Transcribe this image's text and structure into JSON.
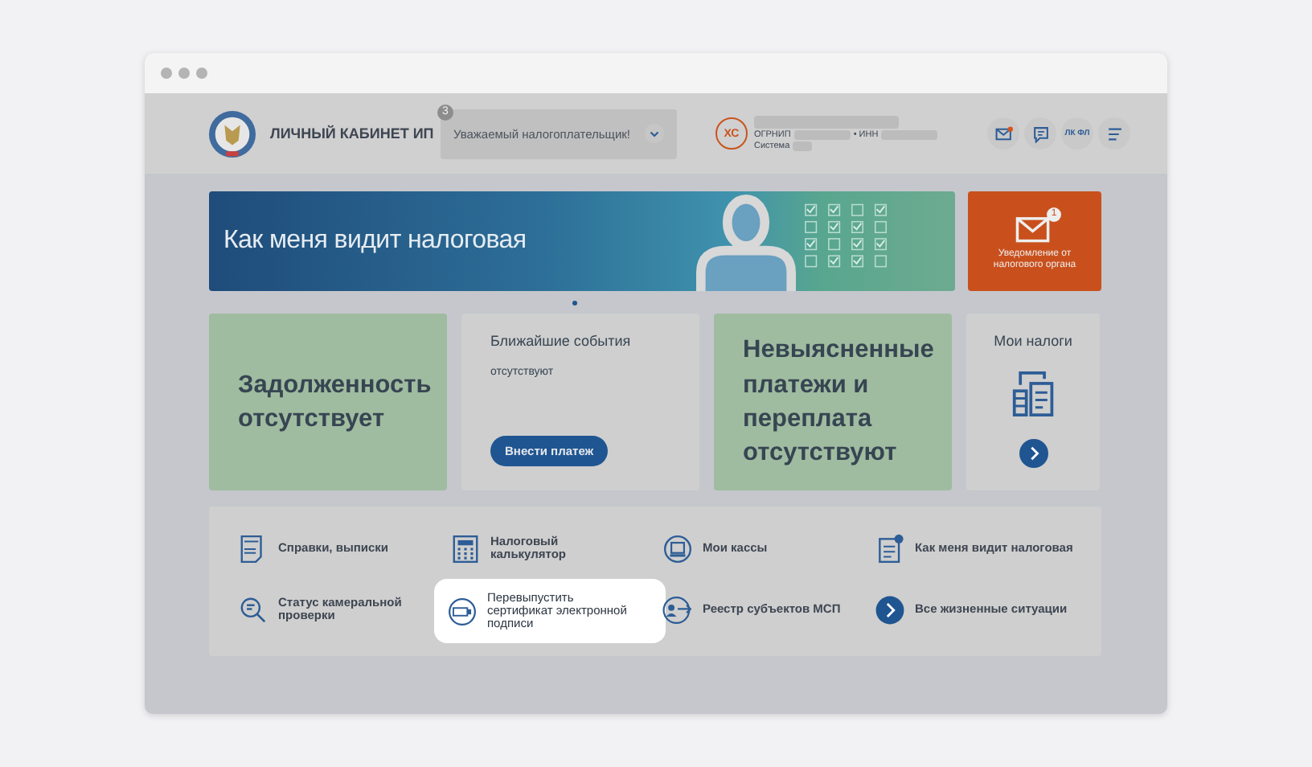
{
  "header": {
    "logo_title": "ЛИЧНЫЙ КАБИНЕТ ИП",
    "message": {
      "badge": "3",
      "text": "Уважаемый налогоплательщик!"
    },
    "user": {
      "initials": "ХС",
      "ogrnip_label": "ОГРНИП",
      "inn_label": "• ИНН",
      "system_label": "Система"
    },
    "actions": [
      {
        "kind": "mail",
        "unread": true
      },
      {
        "kind": "chat"
      },
      {
        "kind": "text",
        "label": "ЛК ФЛ"
      },
      {
        "kind": "menu"
      }
    ]
  },
  "banner": {
    "title": "Как меня видит налоговая",
    "slides": [
      {
        "selected": true
      }
    ]
  },
  "notification": {
    "badge": "1",
    "text": "Уведомление от налогового органа"
  },
  "cards": [
    {
      "kind": "status",
      "text": "Задолженность отсутствует"
    },
    {
      "kind": "events",
      "title": "Ближайшие события",
      "text": "отсутствуют",
      "button": "Внести платеж"
    },
    {
      "kind": "status",
      "text": "Невыясненные платежи и переплата отсутствуют"
    },
    {
      "kind": "taxes",
      "title": "Мои налоги"
    }
  ],
  "links": [
    {
      "kind": "pdf",
      "label": "Справки, выписки",
      "highlighted": false
    },
    {
      "kind": "calculator",
      "label": "Налоговый калькулятор",
      "highlighted": false
    },
    {
      "kind": "register",
      "label": "Мои кассы",
      "highlighted": false
    },
    {
      "kind": "clipboard",
      "label": "Как меня видит налоговая",
      "highlighted": false
    },
    {
      "kind": "magnifier",
      "label": "Статус камеральной проверки",
      "highlighted": false
    },
    {
      "kind": "card",
      "label": "Перевыпустить сертификат электронной подписи",
      "highlighted": true
    },
    {
      "kind": "registry",
      "label": "Реестр субъектов МСП",
      "highlighted": false
    },
    {
      "kind": "chevron",
      "label": "Все жизненные ситуации",
      "highlighted": false
    }
  ]
}
